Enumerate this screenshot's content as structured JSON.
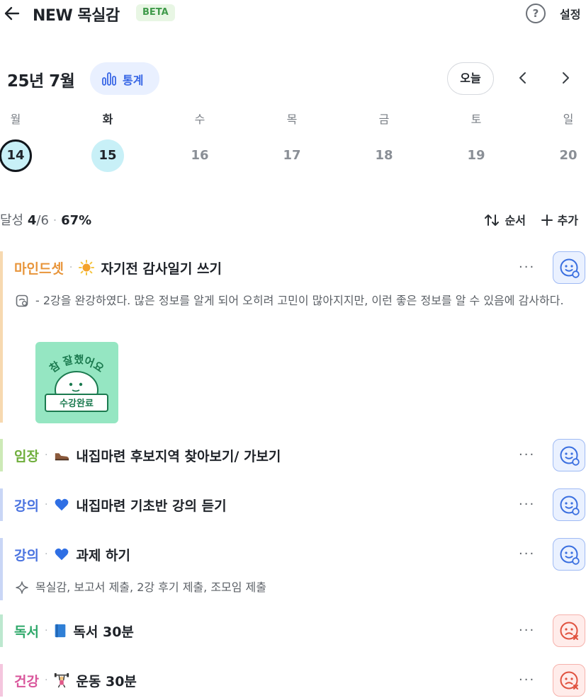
{
  "header": {
    "title": "NEW 목실감",
    "badge": "BETA",
    "help_glyph": "?",
    "settings_label": "설정"
  },
  "calendar": {
    "month_label": "25년 7월",
    "stats_label": "통계",
    "today_label": "오늘",
    "days": [
      {
        "weekday": "월",
        "date": "14",
        "state": "selected"
      },
      {
        "weekday": "화",
        "date": "15",
        "state": "today"
      },
      {
        "weekday": "수",
        "date": "16",
        "state": "normal"
      },
      {
        "weekday": "목",
        "date": "17",
        "state": "normal"
      },
      {
        "weekday": "금",
        "date": "18",
        "state": "normal"
      },
      {
        "weekday": "토",
        "date": "19",
        "state": "normal"
      },
      {
        "weekday": "일",
        "date": "20",
        "state": "normal"
      }
    ]
  },
  "summary": {
    "label": "달성",
    "done": "4",
    "total": "/6",
    "percent": "67%",
    "sort_label": "순서",
    "add_label": "추가"
  },
  "tasks": [
    {
      "category": "마인드셋",
      "category_color": "#e8953a",
      "bar_color": "#f7d9b0",
      "icon": "sun-icon",
      "name": "자기전 감사일기 쓰기",
      "status": "ok",
      "note": "- 2강을 완강하였다. 많은 정보를 알게 되어 오히려 고민이 많아지지만, 이런 좋은 정보를 알 수 있음에 감사하다.",
      "sticker_text": "참 잘했어요",
      "sticker_sign": "수강완료"
    },
    {
      "category": "임장",
      "category_color": "#6fae3c",
      "bar_color": "#cdeab7",
      "icon": "shoe-icon",
      "name": "내집마련 후보지역 찾아보기/ 가보기",
      "status": "ok"
    },
    {
      "category": "강의",
      "category_color": "#4a73e0",
      "bar_color": "#c9d6f6",
      "icon": "blue-heart-icon",
      "name": "내집마련 기초반 강의 듣기",
      "status": "ok"
    },
    {
      "category": "강의",
      "category_color": "#4a73e0",
      "bar_color": "#c9d6f6",
      "icon": "blue-heart-icon",
      "name": "과제 하기",
      "status": "ok",
      "note": "목실감, 보고서 제출, 2강 후기 제출, 조모임 제출"
    },
    {
      "category": "독서",
      "category_color": "#2fa86a",
      "bar_color": "#bde8cf",
      "icon": "blue-book-icon",
      "name": "독서 30분",
      "status": "fail"
    },
    {
      "category": "건강",
      "category_color": "#d9559b",
      "bar_color": "#f4c6de",
      "icon": "weightlifter-icon",
      "name": "운동 30분",
      "status": "fail"
    }
  ],
  "colors": {
    "accent_blue": "#3867e6",
    "today_fill": "#c8f0f7",
    "ok_bg": "#eaf1ff",
    "fail_bg": "#ffecea"
  }
}
